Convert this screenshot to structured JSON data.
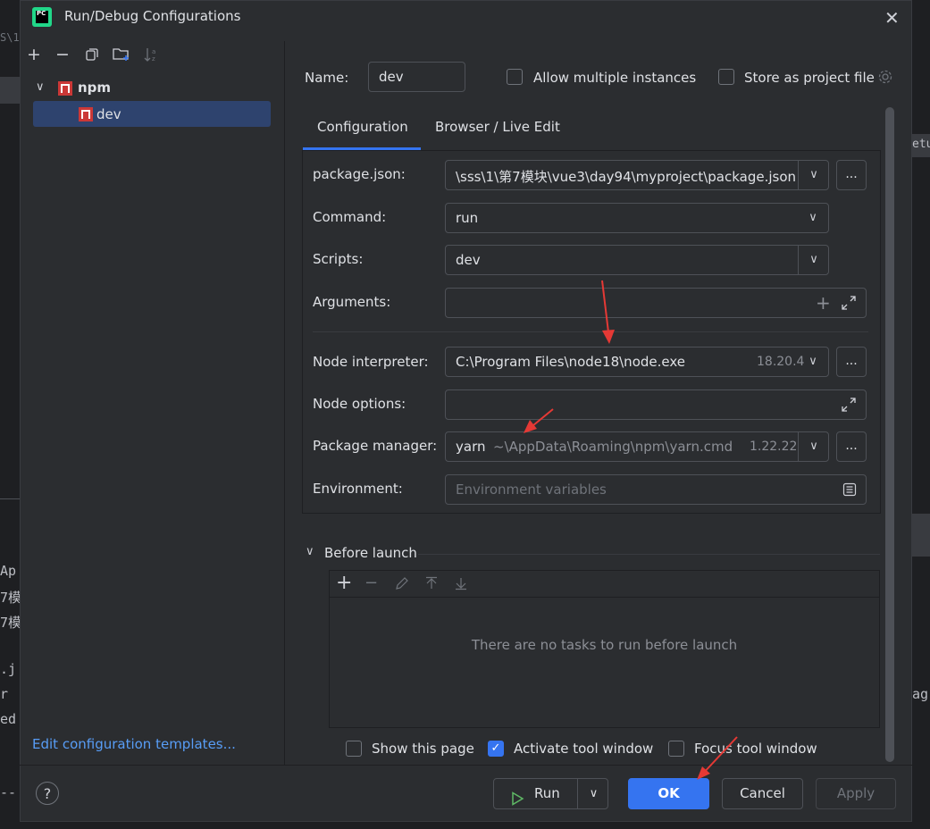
{
  "background": {
    "lines": [
      "Ap",
      "7模",
      "7模",
      ".j",
      "r",
      "ed",
      "--"
    ],
    "right_tail": [
      "etu",
      "ag"
    ],
    "top_frag": "S\\1\\"
  },
  "dialog": {
    "title": "Run/Debug Configurations",
    "icons": {
      "app": "pycharm-icon",
      "close": "close-icon"
    }
  },
  "toolbar": {
    "icons": [
      "add-icon",
      "remove-icon",
      "copy-icon",
      "new-folder-icon",
      "sort-icon"
    ]
  },
  "tree": {
    "group_label": "npm",
    "item_label": "dev"
  },
  "left_footer": {
    "edit_templates": "Edit configuration templates..."
  },
  "name_row": {
    "label": "Name:",
    "value": "dev",
    "allow_multiple": "Allow multiple instances",
    "store_project": "Store as project file"
  },
  "tabs": {
    "configuration": "Configuration",
    "browser": "Browser / Live Edit"
  },
  "form": {
    "package_json": {
      "label": "package.json:",
      "value": "\\sss\\1\\第7模块\\vue3\\day94\\myproject\\package.json"
    },
    "command": {
      "label": "Command:",
      "value": "run"
    },
    "scripts": {
      "label": "Scripts:",
      "value": "dev"
    },
    "arguments": {
      "label": "Arguments:",
      "value": ""
    },
    "node_interpreter": {
      "label": "Node interpreter:",
      "value": "C:\\Program Files\\node18\\node.exe",
      "version": "18.20.4"
    },
    "node_options": {
      "label": "Node options:",
      "value": ""
    },
    "package_manager": {
      "label": "Package manager:",
      "value": "yarn",
      "path": "~\\AppData\\Roaming\\npm\\yarn.cmd",
      "version": "1.22.22"
    },
    "environment": {
      "label": "Environment:",
      "placeholder": "Environment variables"
    },
    "dots_label": "..."
  },
  "before_launch": {
    "label": "Before launch",
    "empty_text": "There are no tasks to run before launch"
  },
  "options": {
    "show_page": {
      "label": "Show this page",
      "checked": false
    },
    "activate_tool": {
      "label": "Activate tool window",
      "checked": true
    },
    "focus_tool": {
      "label": "Focus tool window",
      "checked": false
    }
  },
  "footer": {
    "help": "?",
    "run": "Run",
    "ok": "OK",
    "cancel": "Cancel",
    "apply": "Apply"
  },
  "colors": {
    "accent": "#3574f0",
    "annotation": "#e53935",
    "npm": "#cb3837"
  }
}
